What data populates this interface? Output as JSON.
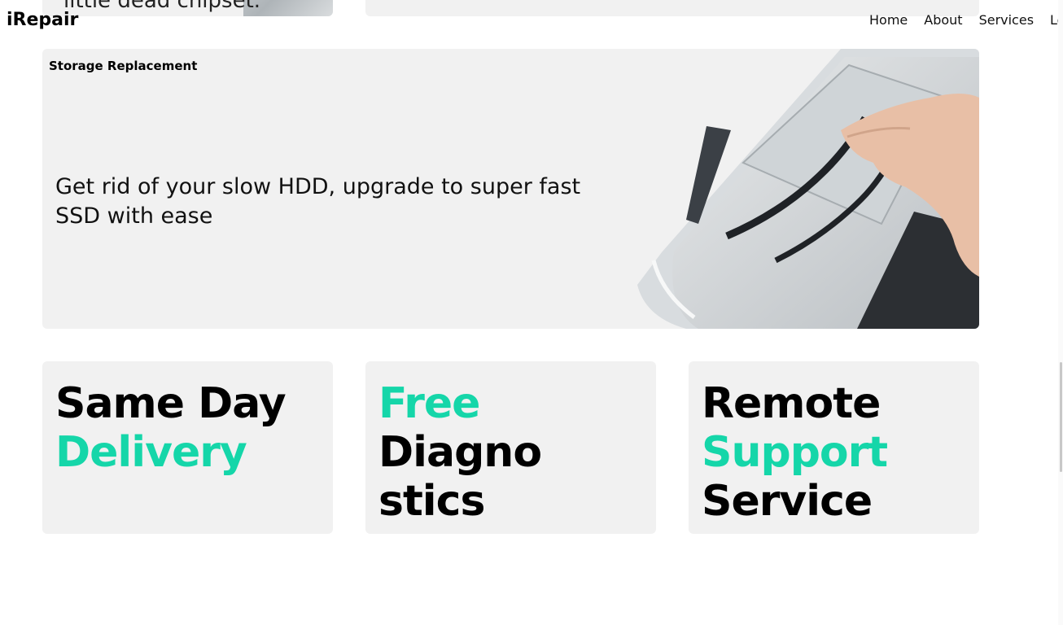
{
  "brand": "iRepair",
  "nav": [
    "Home",
    "About",
    "Services",
    "Log"
  ],
  "prev_card_text": "little dead chipset.",
  "storage": {
    "title": "Storage Replacement",
    "description": "Get rid of your slow HDD, upgrade to super fast SSD with ease"
  },
  "features": {
    "same_day": {
      "line1": "Same Day",
      "line2": "Delivery"
    },
    "free_diag": {
      "line1": "Free",
      "line2": "Diagno",
      "line3": "stics"
    },
    "remote": {
      "line1": "Remote",
      "line2": "Support",
      "line3": "Service"
    }
  },
  "colors": {
    "accent": "#15d6a9",
    "card": "#f1f1f1"
  }
}
